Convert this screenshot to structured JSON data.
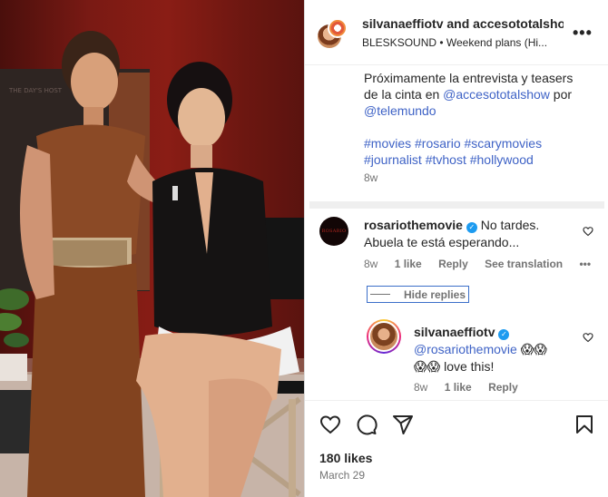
{
  "post": {
    "header": {
      "title": "silvanaeffiotv and accesototalshow",
      "audio": "BLESKSOUND • Weekend plans (Hi...",
      "more_label": "•••"
    },
    "caption": {
      "line1": "Próximamente la entrevista y teasers",
      "line2_prefix": "de la cinta en ",
      "mention1": "@accesototalshow",
      "line2_suffix": " por",
      "mention2": "@telemundo",
      "hashtags_line1": "#movies #rosario #scarymovies",
      "hashtags_line2": "#journalist #tvhost #hollywood",
      "time": "8w"
    },
    "photo_poster_text": "THE DAY'S HOST"
  },
  "comments": [
    {
      "avatar_text": "ROSARIO",
      "username": "rosariothemovie",
      "verified_glyph": "✓",
      "text_part1": " No tardes.",
      "text_part2": "Abuela te está esperando...",
      "time": "8w",
      "likes": "1 like",
      "reply": "Reply",
      "see_translation": "See translation",
      "more": "•••"
    }
  ],
  "hide_replies_label": "Hide replies",
  "reply": {
    "username": "silvanaeffiotv",
    "verified_glyph": "✓",
    "mention": "@rosariothemovie",
    "emoji1": "😱😱",
    "emoji2": "😱😱",
    "text": " love this!",
    "time": "8w",
    "likes": "1 like",
    "reply": "Reply"
  },
  "footer": {
    "likes": "180 likes",
    "date": "March 29"
  },
  "icons": [
    "heart-icon",
    "comment-icon",
    "share-icon",
    "bookmark-icon",
    "more-icon",
    "verified-icon"
  ],
  "colors": {
    "link": "#3f63c6",
    "verified": "#1d9bf0",
    "muted": "#737373",
    "text": "#262626"
  }
}
